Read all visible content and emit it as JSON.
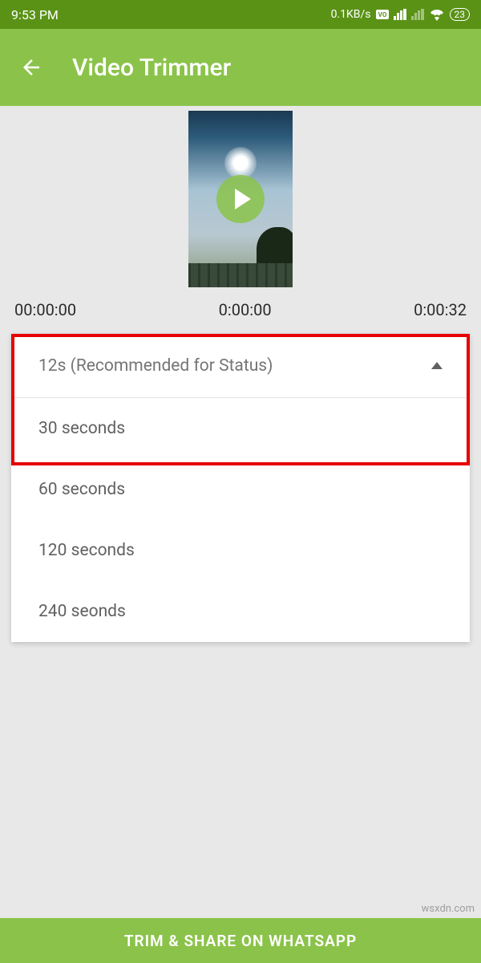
{
  "statusBar": {
    "time": "9:53 PM",
    "speed": "0.1KB/s",
    "battery": "23"
  },
  "appBar": {
    "title": "Video Trimmer"
  },
  "times": {
    "start": "00:00:00",
    "current": "0:00:00",
    "end": "0:00:32"
  },
  "dropdown": {
    "selected": "12s (Recommended for Status)",
    "options": [
      "30 seconds",
      "60 seconds",
      "120 seconds",
      "240 seonds"
    ]
  },
  "cta": "TRIM & SHARE ON WHATSAPP",
  "watermark": "wsxdn.com"
}
